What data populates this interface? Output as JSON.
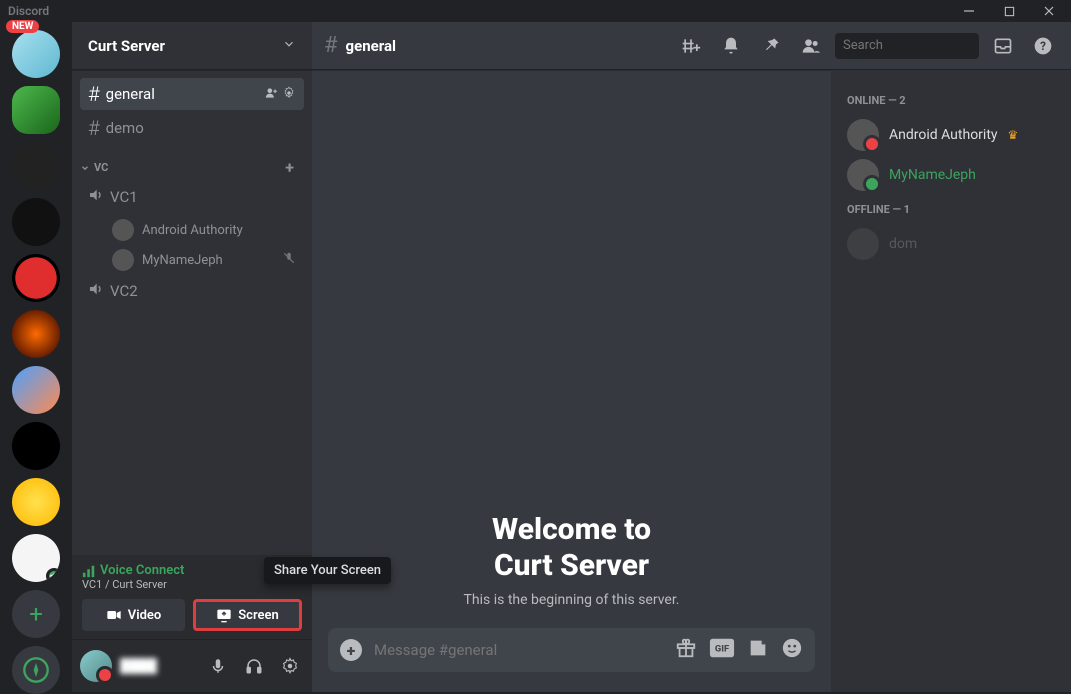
{
  "app": {
    "title": "Discord"
  },
  "server_rail": {
    "new_badge": "NEW",
    "servers": [
      {
        "bg": "linear-gradient(135deg,#a8e0f0,#5fb8d0)"
      },
      {
        "bg": "linear-gradient(135deg,#4db84d,#1a661a)"
      },
      {
        "bg": "#222"
      },
      {
        "bg": "#111"
      },
      {
        "bg": "radial-gradient(circle,#e02d2d 60%,#000 62%)"
      },
      {
        "bg": "radial-gradient(circle,#ff6a00,#2a0000)"
      },
      {
        "bg": "linear-gradient(135deg,#4da0ff,#ff8a50)"
      },
      {
        "bg": "#000"
      },
      {
        "bg": "radial-gradient(circle,#ffe14d,#ffb700)"
      },
      {
        "bg": "#f5f5f5"
      }
    ]
  },
  "sidebar": {
    "server_name": "Curt Server",
    "channels": {
      "text": [
        {
          "name": "general",
          "active": true
        },
        {
          "name": "demo",
          "active": false
        }
      ],
      "voice_category": "VC",
      "voice": [
        {
          "name": "VC1",
          "users": [
            {
              "name": "Android Authority",
              "muted": false
            },
            {
              "name": "MyNameJeph",
              "muted": true
            }
          ]
        },
        {
          "name": "VC2",
          "users": []
        }
      ]
    },
    "voice_panel": {
      "status": "Voice Connect",
      "sub": "VC1 / Curt Server",
      "video_label": "Video",
      "screen_label": "Screen",
      "tooltip": "Share Your Screen"
    },
    "user": {
      "name": "████"
    }
  },
  "chat": {
    "channel_name": "general",
    "search_placeholder": "Search",
    "welcome_line1": "Welcome to",
    "welcome_line2": "Curt Server",
    "welcome_sub": "This is the beginning of this server.",
    "composer_placeholder": "Message #general"
  },
  "members": {
    "online_label": "ONLINE — 2",
    "offline_label": "OFFLINE — 1",
    "online": [
      {
        "name": "Android Authority",
        "color": "#dcddde",
        "owner": true,
        "status": "dnd"
      },
      {
        "name": "MyNameJeph",
        "color": "#3ba55d",
        "owner": false,
        "status": "online"
      }
    ],
    "offline": [
      {
        "name": "dom",
        "color": "#8e9297"
      }
    ]
  }
}
